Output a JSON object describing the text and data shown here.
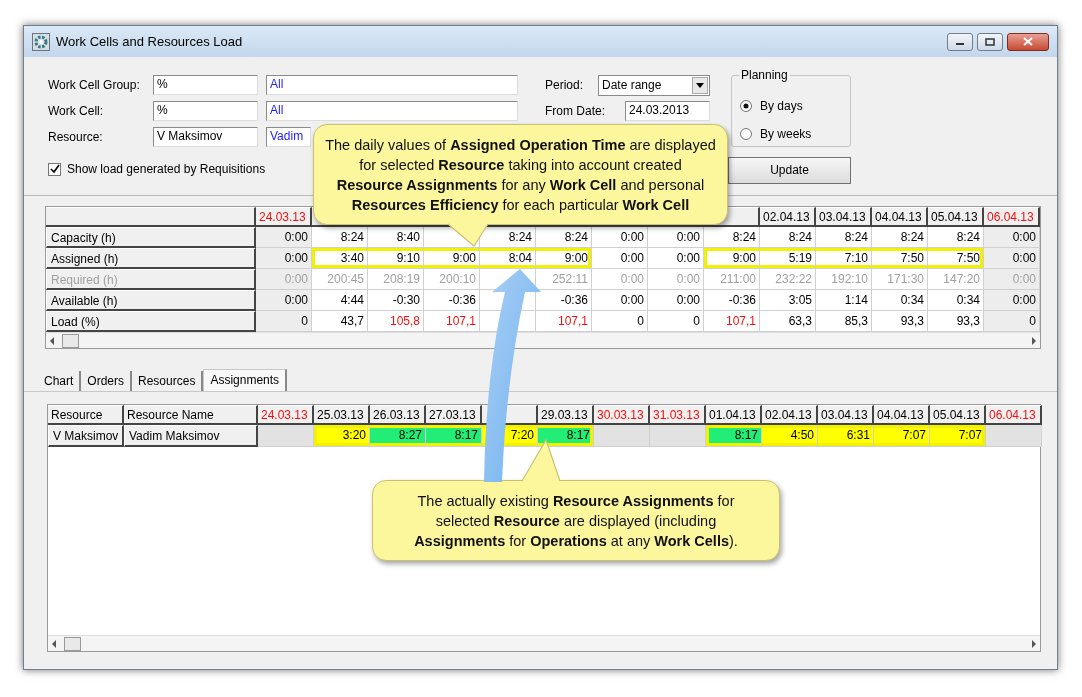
{
  "window": {
    "title": "Work Cells and Resources Load"
  },
  "filters": [
    {
      "label": "Work Cell Group:",
      "code": "%",
      "name": "All"
    },
    {
      "label": "Work Cell:",
      "code": "%",
      "name": "All"
    },
    {
      "label": "Resource:",
      "code": "V Maksimov",
      "name": "Vadim"
    }
  ],
  "show_requisitions": {
    "label": "Show load generated by Requisitions",
    "checked": true
  },
  "period": {
    "label": "Period:",
    "value": "Date range"
  },
  "from_date": {
    "label": "From Date:",
    "value": "24.03.2013"
  },
  "planning": {
    "title": "Planning",
    "options": [
      {
        "label": "By days",
        "selected": true
      },
      {
        "label": "By weeks",
        "selected": false
      }
    ]
  },
  "update_button": "Update",
  "load_table": {
    "columns": [
      {
        "kind": "date",
        "label": "24.03.13",
        "weekend": true
      },
      {
        "kind": "covered"
      },
      {
        "kind": "covered"
      },
      {
        "kind": "covered"
      },
      {
        "kind": "covered"
      },
      {
        "kind": "covered"
      },
      {
        "kind": "covered"
      },
      {
        "kind": "covered"
      },
      {
        "kind": "covered"
      },
      {
        "kind": "date",
        "label": "02.04.13",
        "weekend": false
      },
      {
        "kind": "date",
        "label": "03.04.13",
        "weekend": false
      },
      {
        "kind": "date",
        "label": "04.04.13",
        "weekend": false
      },
      {
        "kind": "date",
        "label": "05.04.13",
        "weekend": false
      },
      {
        "kind": "date",
        "label": "06.04.13",
        "weekend": true
      }
    ],
    "rows": [
      {
        "label": "Capacity (h)",
        "muted": false,
        "cells": [
          "0:00",
          "8:24",
          "8:40",
          null,
          "8:24",
          "8:24",
          "0:00",
          "0:00",
          "8:24",
          "8:24",
          "8:24",
          "8:24",
          "8:24",
          "0:00"
        ]
      },
      {
        "label": "Assigned (h)",
        "muted": false,
        "cells": [
          {
            "text": "0:00",
            "highlighted": false
          },
          {
            "text": "3:40",
            "highlighted": true
          },
          {
            "text": "9:10",
            "highlighted": true
          },
          {
            "text": "9:00",
            "highlighted": true
          },
          {
            "text": "8:04",
            "highlighted": true
          },
          {
            "text": "9:00",
            "highlighted": true
          },
          {
            "text": "0:00",
            "highlighted": false
          },
          {
            "text": "0:00",
            "highlighted": false
          },
          {
            "text": "9:00",
            "highlighted": true
          },
          {
            "text": "5:19",
            "highlighted": true
          },
          {
            "text": "7:10",
            "highlighted": true
          },
          {
            "text": "7:50",
            "highlighted": true
          },
          {
            "text": "7:50",
            "highlighted": true
          },
          {
            "text": "0:00",
            "highlighted": false
          }
        ]
      },
      {
        "label": "Required (h)",
        "muted": true,
        "cells": [
          "0:00",
          "200:45",
          "208:19",
          "200:10",
          null,
          "252:11",
          "0:00",
          "0:00",
          "211:00",
          "232:22",
          "192:10",
          "171:30",
          "147:20",
          "0:00"
        ]
      },
      {
        "label": "Available (h)",
        "muted": false,
        "cells": [
          "0:00",
          "4:44",
          "-0:30",
          "-0:36",
          null,
          "-0:36",
          "0:00",
          "0:00",
          "-0:36",
          "3:05",
          "1:14",
          "0:34",
          "0:34",
          "0:00"
        ]
      },
      {
        "label": "Load (%)",
        "muted": false,
        "cells": [
          {
            "text": "0",
            "over": false
          },
          {
            "text": "43,7",
            "over": false
          },
          {
            "text": "105,8",
            "over": true
          },
          {
            "text": "107,1",
            "over": true
          },
          null,
          {
            "text": "107,1",
            "over": true
          },
          {
            "text": "0",
            "over": false
          },
          {
            "text": "0",
            "over": false
          },
          {
            "text": "107,1",
            "over": true
          },
          {
            "text": "63,3",
            "over": false
          },
          {
            "text": "85,3",
            "over": false
          },
          {
            "text": "93,3",
            "over": false
          },
          {
            "text": "93,3",
            "over": false
          },
          {
            "text": "0",
            "over": false
          }
        ]
      }
    ]
  },
  "tabs": [
    {
      "label": "Chart",
      "selected": false
    },
    {
      "label": "Orders",
      "selected": false
    },
    {
      "label": "Resources",
      "selected": false
    },
    {
      "label": "Assignments",
      "selected": true
    }
  ],
  "assignments_table": {
    "columns": [
      "Resource",
      "Resource Name"
    ],
    "dates": [
      {
        "kind": "date",
        "label": "24.03.13",
        "weekend": true
      },
      {
        "kind": "date",
        "label": "25.03.13",
        "weekend": false
      },
      {
        "kind": "date",
        "label": "26.03.13",
        "weekend": false
      },
      {
        "kind": "date",
        "label": "27.03.13",
        "weekend": false
      },
      {
        "kind": "covered"
      },
      {
        "kind": "date",
        "label": "29.03.13",
        "weekend": false
      },
      {
        "kind": "date",
        "label": "30.03.13",
        "weekend": true
      },
      {
        "kind": "date",
        "label": "31.03.13",
        "weekend": true
      },
      {
        "kind": "date",
        "label": "01.04.13",
        "weekend": false
      },
      {
        "kind": "date",
        "label": "02.04.13",
        "weekend": false
      },
      {
        "kind": "date",
        "label": "03.04.13",
        "weekend": false
      },
      {
        "kind": "date",
        "label": "04.04.13",
        "weekend": false
      },
      {
        "kind": "date",
        "label": "05.04.13",
        "weekend": false
      },
      {
        "kind": "date",
        "label": "06.04.13",
        "weekend": true
      }
    ],
    "rows": [
      {
        "resource": "V Maksimov",
        "name": "Vadim Maksimov",
        "cells": [
          null,
          {
            "text": "3:20",
            "color": "#ffff00",
            "highlighted": true
          },
          {
            "text": "8:27",
            "color": "#22ee77",
            "highlighted": true
          },
          {
            "text": "8:17",
            "color": "#22ee77",
            "highlighted": true
          },
          {
            "text": "7:20",
            "color": "#ffff00",
            "highlighted": true
          },
          {
            "text": "8:17",
            "color": "#22ee77",
            "highlighted": true
          },
          null,
          null,
          {
            "text": "8:17",
            "color": "#22ee77",
            "highlighted": true
          },
          {
            "text": "4:50",
            "color": "#ffff00",
            "highlighted": true
          },
          {
            "text": "6:31",
            "color": "#ffff00",
            "highlighted": true
          },
          {
            "text": "7:07",
            "color": "#ffff00",
            "highlighted": true
          },
          {
            "text": "7:07",
            "color": "#ffff00",
            "highlighted": true
          },
          null
        ]
      }
    ]
  },
  "callouts": [
    {
      "lines": [
        "The daily values of **Assigned Operation Time** are displayed",
        "for selected **Resource**  taking into account created",
        "**Resource Assignments** for any **Work Cell** and personal",
        "**Resources Efficiency** for each particular **Work Cell**"
      ]
    },
    {
      "lines": [
        "The actually existing **Resource Assignments** for",
        "selected **Resource** are displayed (including",
        "**Assignments** for **Operations** at any **Work Cells**)."
      ]
    }
  ]
}
